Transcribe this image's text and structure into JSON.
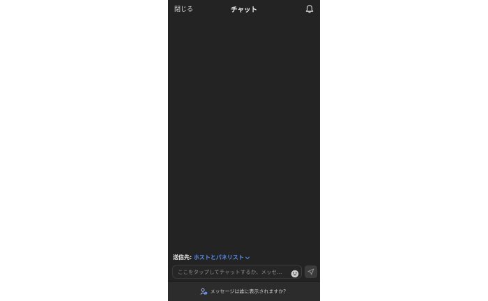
{
  "header": {
    "close_label": "閉じる",
    "title": "チャット"
  },
  "recipient": {
    "label": "送信先:",
    "value": "ホストとパネリスト"
  },
  "composer": {
    "placeholder": "ここをタップしてチャットするか、メッセ…"
  },
  "footer": {
    "text": "メッセージは誰に表示されますか？"
  },
  "icons": {
    "bell": "bell-icon",
    "chevron": "chevron-down-icon",
    "emoji": "emoji-icon",
    "send": "send-icon",
    "visibility": "people-visibility-icon"
  },
  "colors": {
    "background": "#232323",
    "accent": "#5b8ff0"
  }
}
